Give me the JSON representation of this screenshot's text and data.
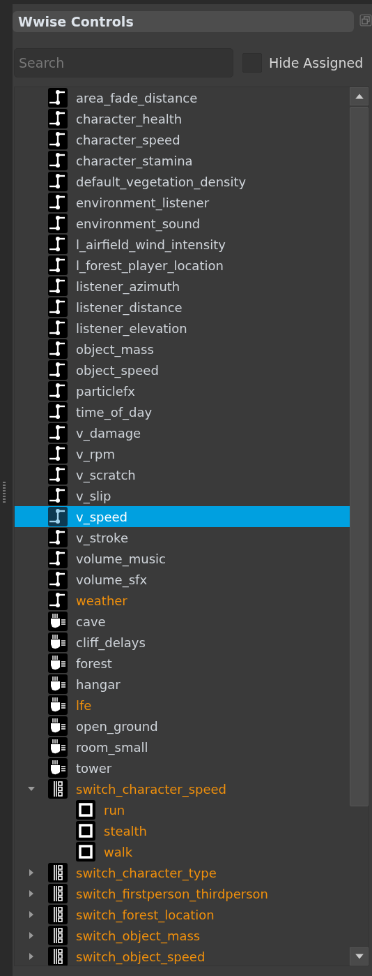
{
  "panel": {
    "title": "Wwise Controls"
  },
  "search": {
    "placeholder": "Search"
  },
  "hide_assigned": {
    "label": "Hide Assigned",
    "checked": false
  },
  "tree": [
    {
      "label": "area_fade_distance",
      "kind": "rtpc",
      "selected": false,
      "unassigned": false
    },
    {
      "label": "character_health",
      "kind": "rtpc",
      "selected": false,
      "unassigned": false
    },
    {
      "label": "character_speed",
      "kind": "rtpc",
      "selected": false,
      "unassigned": false
    },
    {
      "label": "character_stamina",
      "kind": "rtpc",
      "selected": false,
      "unassigned": false
    },
    {
      "label": "default_vegetation_density",
      "kind": "rtpc",
      "selected": false,
      "unassigned": false
    },
    {
      "label": "environment_listener",
      "kind": "rtpc",
      "selected": false,
      "unassigned": false
    },
    {
      "label": "environment_sound",
      "kind": "rtpc",
      "selected": false,
      "unassigned": false
    },
    {
      "label": "l_airfield_wind_intensity",
      "kind": "rtpc",
      "selected": false,
      "unassigned": false
    },
    {
      "label": "l_forest_player_location",
      "kind": "rtpc",
      "selected": false,
      "unassigned": false
    },
    {
      "label": "listener_azimuth",
      "kind": "rtpc",
      "selected": false,
      "unassigned": false
    },
    {
      "label": "listener_distance",
      "kind": "rtpc",
      "selected": false,
      "unassigned": false
    },
    {
      "label": "listener_elevation",
      "kind": "rtpc",
      "selected": false,
      "unassigned": false
    },
    {
      "label": "object_mass",
      "kind": "rtpc",
      "selected": false,
      "unassigned": false
    },
    {
      "label": "object_speed",
      "kind": "rtpc",
      "selected": false,
      "unassigned": false
    },
    {
      "label": "particlefx",
      "kind": "rtpc",
      "selected": false,
      "unassigned": false
    },
    {
      "label": "time_of_day",
      "kind": "rtpc",
      "selected": false,
      "unassigned": false
    },
    {
      "label": "v_damage",
      "kind": "rtpc",
      "selected": false,
      "unassigned": false
    },
    {
      "label": "v_rpm",
      "kind": "rtpc",
      "selected": false,
      "unassigned": false
    },
    {
      "label": "v_scratch",
      "kind": "rtpc",
      "selected": false,
      "unassigned": false
    },
    {
      "label": "v_slip",
      "kind": "rtpc",
      "selected": false,
      "unassigned": false
    },
    {
      "label": "v_speed",
      "kind": "rtpc",
      "selected": true,
      "unassigned": false
    },
    {
      "label": "v_stroke",
      "kind": "rtpc",
      "selected": false,
      "unassigned": false
    },
    {
      "label": "volume_music",
      "kind": "rtpc",
      "selected": false,
      "unassigned": false
    },
    {
      "label": "volume_sfx",
      "kind": "rtpc",
      "selected": false,
      "unassigned": false
    },
    {
      "label": "weather",
      "kind": "rtpc",
      "selected": false,
      "unassigned": true
    },
    {
      "label": "cave",
      "kind": "aux",
      "selected": false,
      "unassigned": false
    },
    {
      "label": "cliff_delays",
      "kind": "aux",
      "selected": false,
      "unassigned": false
    },
    {
      "label": "forest",
      "kind": "aux",
      "selected": false,
      "unassigned": false
    },
    {
      "label": "hangar",
      "kind": "aux",
      "selected": false,
      "unassigned": false
    },
    {
      "label": "lfe",
      "kind": "aux",
      "selected": false,
      "unassigned": true
    },
    {
      "label": "open_ground",
      "kind": "aux",
      "selected": false,
      "unassigned": false
    },
    {
      "label": "room_small",
      "kind": "aux",
      "selected": false,
      "unassigned": false
    },
    {
      "label": "tower",
      "kind": "aux",
      "selected": false,
      "unassigned": false
    },
    {
      "label": "switch_character_speed",
      "kind": "switch_group",
      "selected": false,
      "unassigned": true,
      "expanded": true,
      "children": [
        {
          "label": "run",
          "kind": "switch_state",
          "selected": false,
          "unassigned": true
        },
        {
          "label": "stealth",
          "kind": "switch_state",
          "selected": false,
          "unassigned": true
        },
        {
          "label": "walk",
          "kind": "switch_state",
          "selected": false,
          "unassigned": true
        }
      ]
    },
    {
      "label": "switch_character_type",
      "kind": "switch_group",
      "selected": false,
      "unassigned": true,
      "expanded": false
    },
    {
      "label": "switch_firstperson_thirdperson",
      "kind": "switch_group",
      "selected": false,
      "unassigned": true,
      "expanded": false
    },
    {
      "label": "switch_forest_location",
      "kind": "switch_group",
      "selected": false,
      "unassigned": true,
      "expanded": false
    },
    {
      "label": "switch_object_mass",
      "kind": "switch_group",
      "selected": false,
      "unassigned": true,
      "expanded": false
    },
    {
      "label": "switch_object_speed",
      "kind": "switch_group",
      "selected": false,
      "unassigned": true,
      "expanded": false
    }
  ]
}
